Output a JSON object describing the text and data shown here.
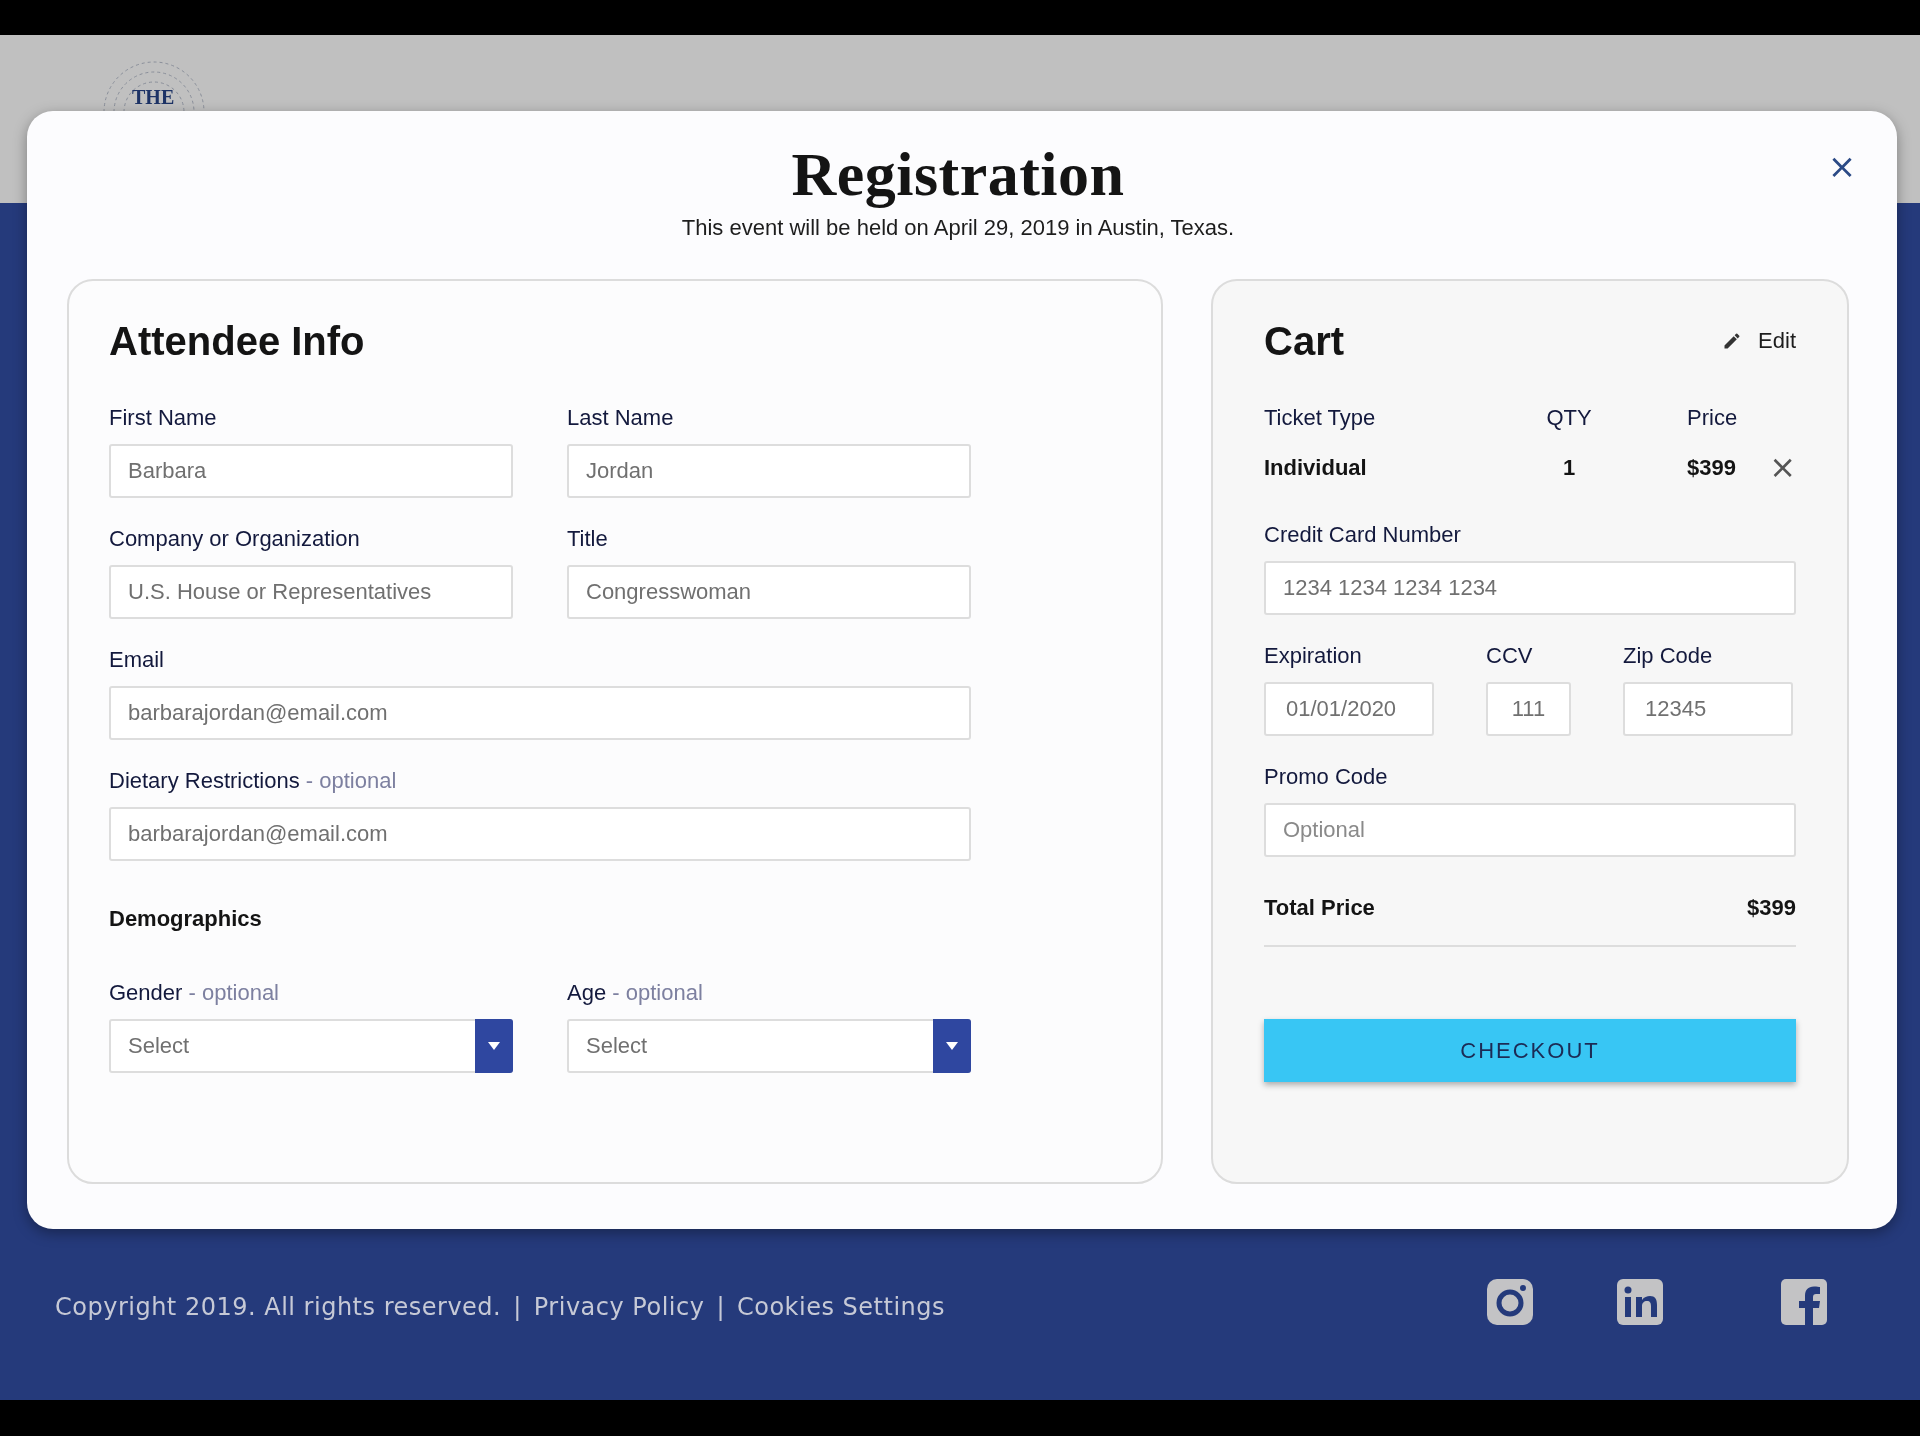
{
  "site_header": {
    "logo_text": "THE"
  },
  "modal": {
    "title": "Registration",
    "subtitle": "This event will be held on April 29, 2019 in Austin, Texas.",
    "close": "×"
  },
  "attendee": {
    "heading": "Attendee Info",
    "rows": [
      [
        {
          "label": "First Name",
          "value": "Barbara"
        },
        {
          "label": "Last Name",
          "value": "Jordan"
        }
      ],
      [
        {
          "label": "Company or Organization",
          "value": "U.S. House or Representatives"
        },
        {
          "label": "Title",
          "value": "Congresswoman"
        }
      ],
      [
        {
          "label": "Email",
          "value": "barbarajordan@email.com"
        }
      ],
      [
        {
          "label": "Dietary Restrictions",
          "note": "- optional",
          "value": "barbarajordan@email.com"
        }
      ]
    ],
    "demographics": {
      "heading": "Demographics",
      "selects": [
        {
          "label": "Gender",
          "note": "- optional",
          "value": "Select"
        },
        {
          "label": "Age",
          "note": "- optional",
          "value": "Select"
        }
      ]
    }
  },
  "cart": {
    "heading": "Cart",
    "edit": "Edit",
    "columns": [
      "Ticket Type",
      "QTY",
      "Price"
    ],
    "items": [
      {
        "ticket_type": "Individual",
        "qty": "1",
        "price": "$399",
        "remove": "×"
      }
    ],
    "rows": [
      [
        {
          "label": "Credit Card Number",
          "value": "1234 1234 1234 1234"
        }
      ],
      [
        {
          "label": "Expiration",
          "value": "01/01/2020"
        },
        {
          "label": "CCV",
          "value": "111"
        },
        {
          "label": "Zip Code",
          "value": "12345"
        }
      ],
      [
        {
          "label": "Promo Code",
          "placeholder": "Optional"
        }
      ]
    ],
    "total_label": "Total Price",
    "total_value": "$399",
    "checkout": "CHECKOUT"
  },
  "footer": {
    "copyright": "Copyright 2019. All rights reserved.",
    "links": [
      "Privacy Policy",
      "Cookies Settings"
    ],
    "separator": "|"
  }
}
